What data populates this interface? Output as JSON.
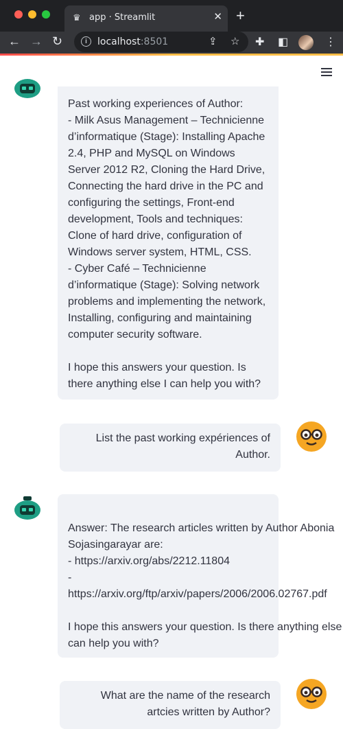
{
  "browser": {
    "tab_title": "app · Streamlit",
    "tab_favicon": "crown-icon",
    "url_host": "localhost",
    "url_port": ":8501"
  },
  "chat": {
    "messages": [
      {
        "role": "assistant",
        "text": "Past working experiences of Author:\n- Milk Asus Management – Technicienne d’informatique (Stage): Installing Apache 2.4, PHP and MySQL on Windows Server 2012 R2, Cloning the Hard Drive, Connecting the hard drive in the PC and configuring the settings, Front-end development, Tools and techniques: Clone of hard drive, configuration of Windows server system, HTML, CSS.\n- Cyber Café – Technicienne d’informatique (Stage): Solving network problems and implementing the network, Installing, configuring and maintaining computer security software.\n\nI hope this answers your question. Is there anything else I can help you with?"
      },
      {
        "role": "user",
        "text": "List the past working expériences of Author."
      },
      {
        "role": "assistant",
        "text": "\nAnswer: The research articles written by Author Abonia Sojasingarayar are:\n- https://arxiv.org/abs/2212.11804\n-\nhttps://arxiv.org/ftp/arxiv/papers/2006/2006.02767.pdf\n\nI hope this answers your question. Is there anything else I can help you with?"
      },
      {
        "role": "user",
        "text": "What are the name of the research artcies written by Author?"
      }
    ]
  },
  "colors": {
    "bubble_bg": "#f0f2f6",
    "text": "#31333f",
    "browser_dark": "#202124",
    "accent_red": "#ff4b4b",
    "accent_yellow": "#ffbd45"
  }
}
